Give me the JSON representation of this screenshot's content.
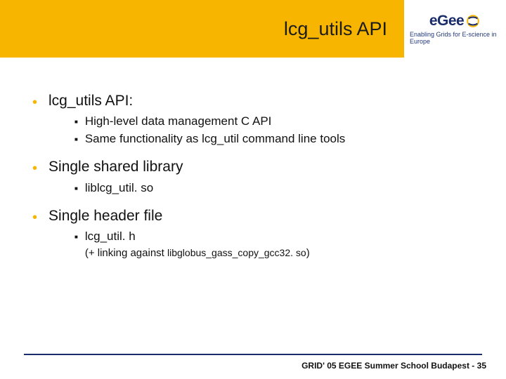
{
  "header": {
    "title": "lcg_utils API",
    "logo": {
      "name": "eGee",
      "tagline": "Enabling Grids for E-science in Europe"
    }
  },
  "bullets": [
    {
      "text": "lcg_utils API:",
      "subs": [
        {
          "text": "High-level data management C API"
        },
        {
          "text": "Same functionality as lcg_util command line tools"
        }
      ]
    },
    {
      "text": "Single shared library",
      "subs": [
        {
          "text": "liblcg_util. so"
        }
      ]
    },
    {
      "text": "Single header file",
      "subs": [
        {
          "text": "lcg_util. h",
          "extra_prefix": "(+ linking against ",
          "extra_code": "libglobus_gass_copy_gcc32. so",
          "extra_suffix": ")"
        }
      ]
    }
  ],
  "footer": {
    "text_prefix": "GRID' 05 EGEE Summer School Budapest - ",
    "page": "35"
  }
}
